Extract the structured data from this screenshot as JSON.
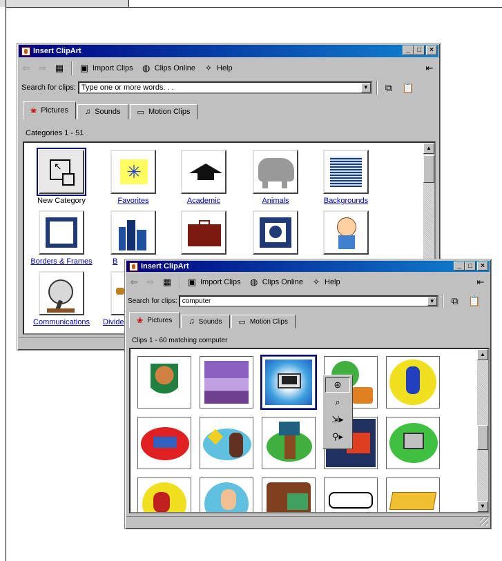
{
  "window_back": {
    "title": "Insert ClipArt",
    "toolbar": {
      "import_label": "Import Clips",
      "online_label": "Clips Online",
      "help_label": "Help"
    },
    "search": {
      "label": "Search for clips:",
      "value": "Type one or more words. . ."
    },
    "tabs": [
      {
        "label": "Pictures"
      },
      {
        "label": "Sounds"
      },
      {
        "label": "Motion Clips"
      }
    ],
    "caption": "Categories 1 - 51",
    "categories": [
      {
        "label": "New Category",
        "icon": "new-category-icon"
      },
      {
        "label": "Favorites",
        "icon": "star-icon"
      },
      {
        "label": "Academic",
        "icon": "graduation-cap-icon"
      },
      {
        "label": "Animals",
        "icon": "elephant-icon"
      },
      {
        "label": "Backgrounds",
        "icon": "background-grid-icon"
      },
      {
        "label": "Borders & Frames",
        "icon": "frame-icon"
      },
      {
        "label": "B",
        "icon": "buildings-icon"
      },
      {
        "label": "",
        "icon": "briefcase-icon"
      },
      {
        "label": "",
        "icon": "square-frame-icon"
      },
      {
        "label": "",
        "icon": "cartoon-baby-icon"
      },
      {
        "label": "Communications",
        "icon": "satellite-dish-icon"
      },
      {
        "label": "Divide",
        "icon": "divider-icon"
      }
    ]
  },
  "window_front": {
    "title": "Insert ClipArt",
    "toolbar": {
      "import_label": "Import Clips",
      "online_label": "Clips Online",
      "help_label": "Help"
    },
    "search": {
      "label": "Search for clips:",
      "value": "computer"
    },
    "tabs": [
      {
        "label": "Pictures"
      },
      {
        "label": "Sounds"
      },
      {
        "label": "Motion Clips"
      }
    ],
    "caption": "Clips 1 - 60 matching computer",
    "clips": [
      {
        "icon": "person-juggling-icon"
      },
      {
        "icon": "office-desk-icon"
      },
      {
        "icon": "computer-monitor-icon"
      },
      {
        "icon": "globe-computer-icon"
      },
      {
        "icon": "businessman-running-icon"
      },
      {
        "icon": "flying-man-icon"
      },
      {
        "icon": "road-sign-man-icon"
      },
      {
        "icon": "computer-tree-icon"
      },
      {
        "icon": "city-computer-icon"
      },
      {
        "icon": "rainbow-computer-icon"
      },
      {
        "icon": "woman-laptop-icon"
      },
      {
        "icon": "man-computer-icon"
      },
      {
        "icon": "people-computer-icon"
      },
      {
        "icon": "keyboard-mouse-icon"
      },
      {
        "icon": "keyboard-icon"
      }
    ],
    "popup_menu": [
      {
        "icon": "insert-clip-icon"
      },
      {
        "icon": "preview-magnifier-icon"
      },
      {
        "icon": "add-to-category-icon"
      },
      {
        "icon": "find-similar-icon"
      }
    ]
  },
  "colors": {
    "title_start": "#000080",
    "title_end": "#1084d0",
    "face": "#c0c0c0",
    "link": "#0000aa"
  }
}
